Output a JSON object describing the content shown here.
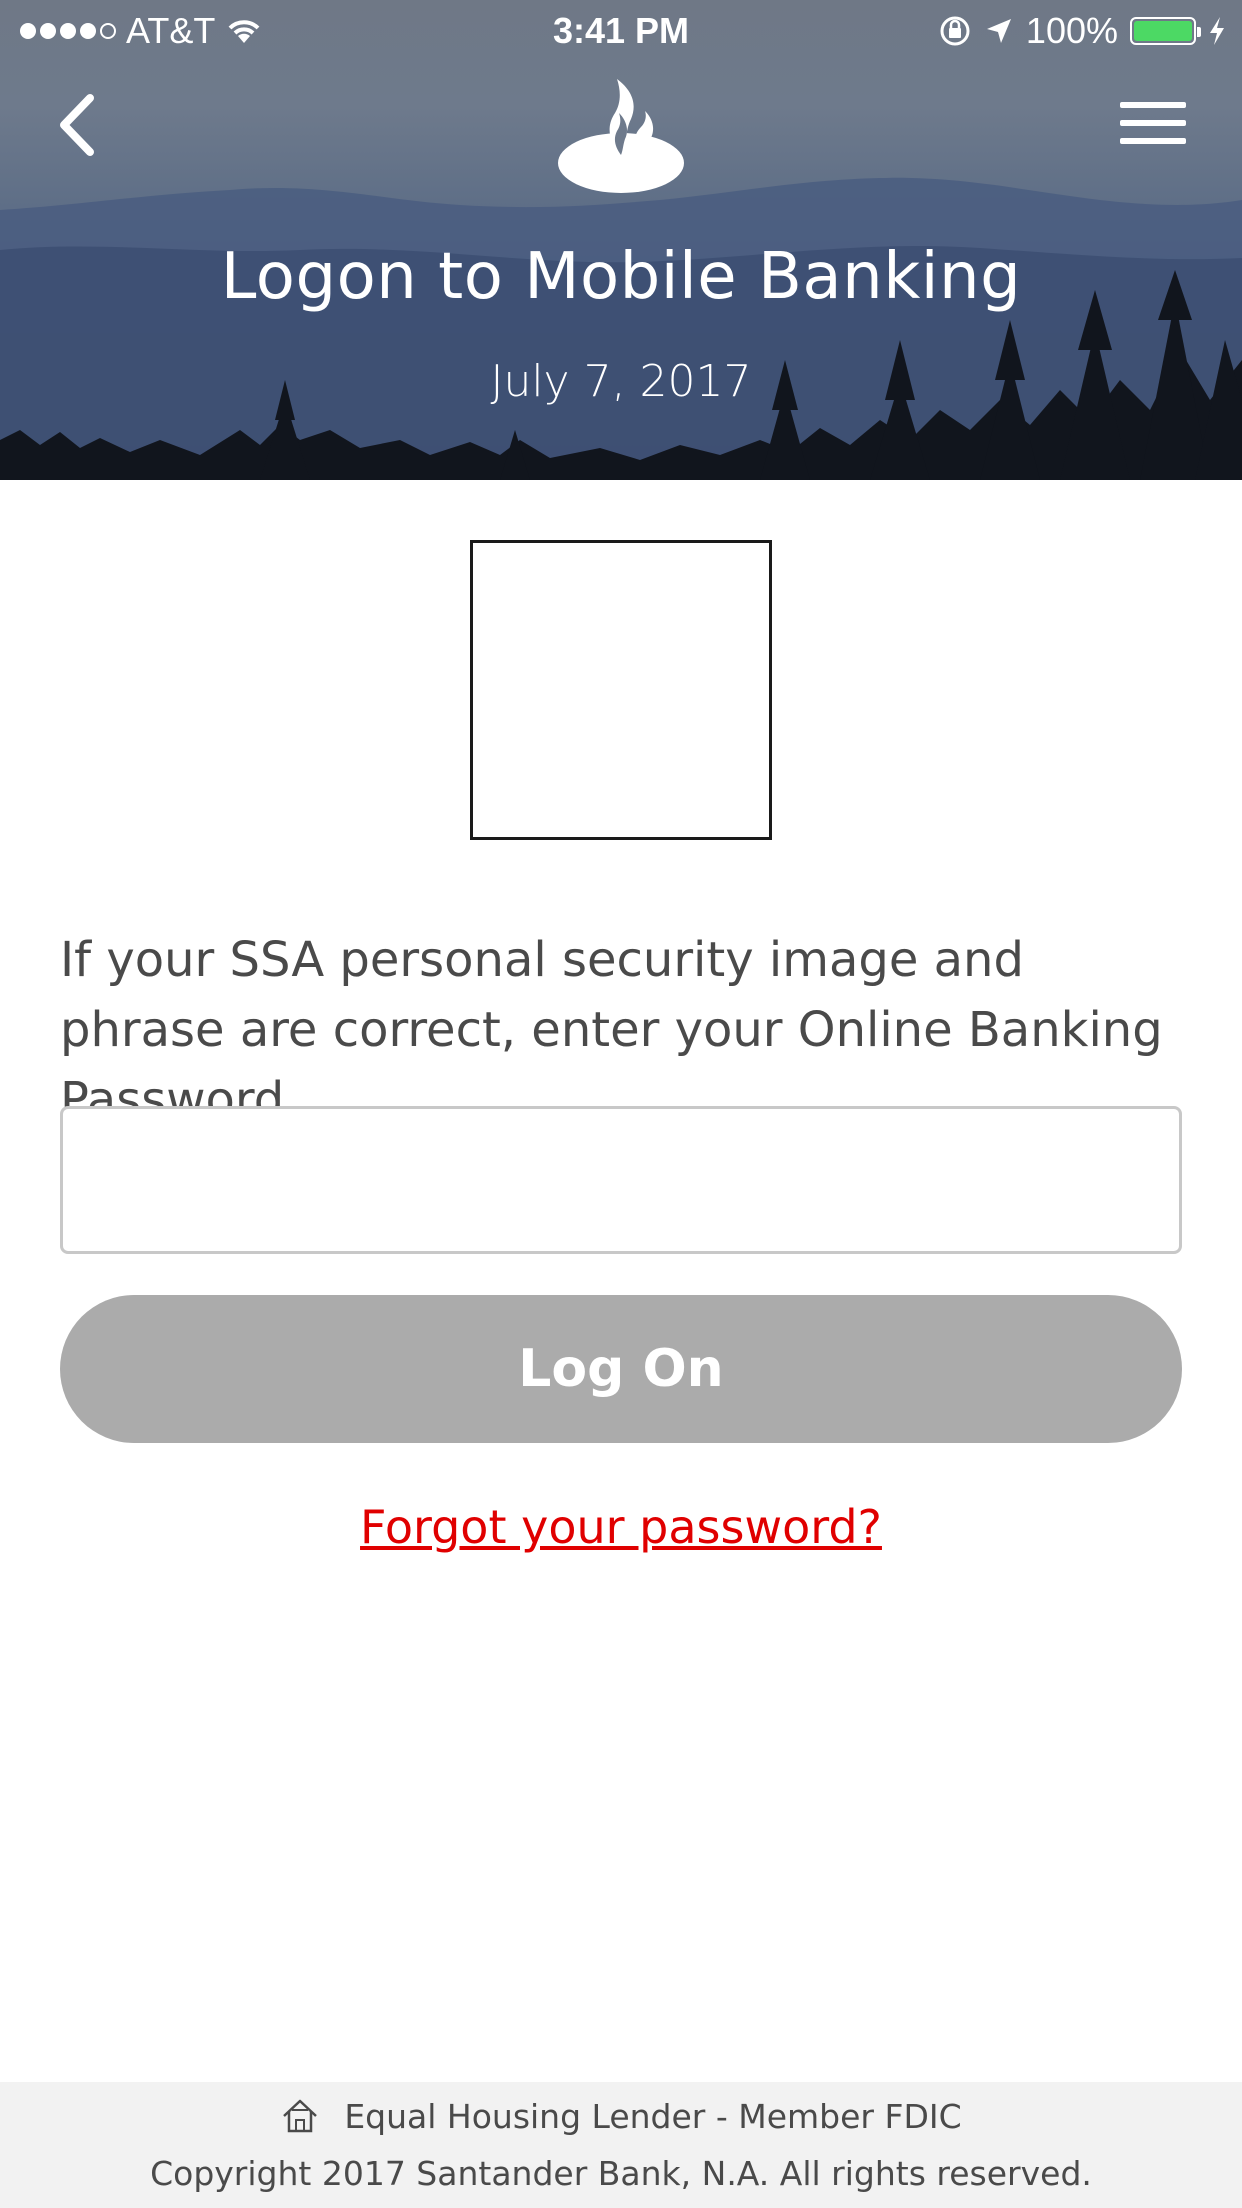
{
  "status_bar": {
    "carrier": "AT&T",
    "time": "3:41 PM",
    "battery": "100%",
    "signal_bars_filled": 4,
    "signal_bars_total": 5,
    "icons": [
      "wifi-icon",
      "rotation-lock-icon",
      "location-arrow-icon",
      "battery-icon",
      "charging-bolt-icon"
    ]
  },
  "header": {
    "title": "Logon to Mobile Banking",
    "date": "July 7, 2017",
    "icons": [
      "chevron-left-icon",
      "santander-flame-logo",
      "hamburger-menu-icon"
    ]
  },
  "login": {
    "instructions": "If your SSA personal security image and phrase are correct, enter your Online Banking Password",
    "password_value": "",
    "logon_label": "Log On",
    "forgot_label": "Forgot your password?"
  },
  "footer": {
    "lender_text": "Equal Housing Lender - Member FDIC",
    "copyright": "Copyright 2017 Santander Bank, N.A. All rights reserved.",
    "icon": "house-icon"
  },
  "colors": {
    "header_sky": "#6e7a8c",
    "button_disabled": "#ababab",
    "link_red": "#e00000",
    "battery_green": "#4cd964",
    "footer_bg": "#f2f2f2"
  }
}
